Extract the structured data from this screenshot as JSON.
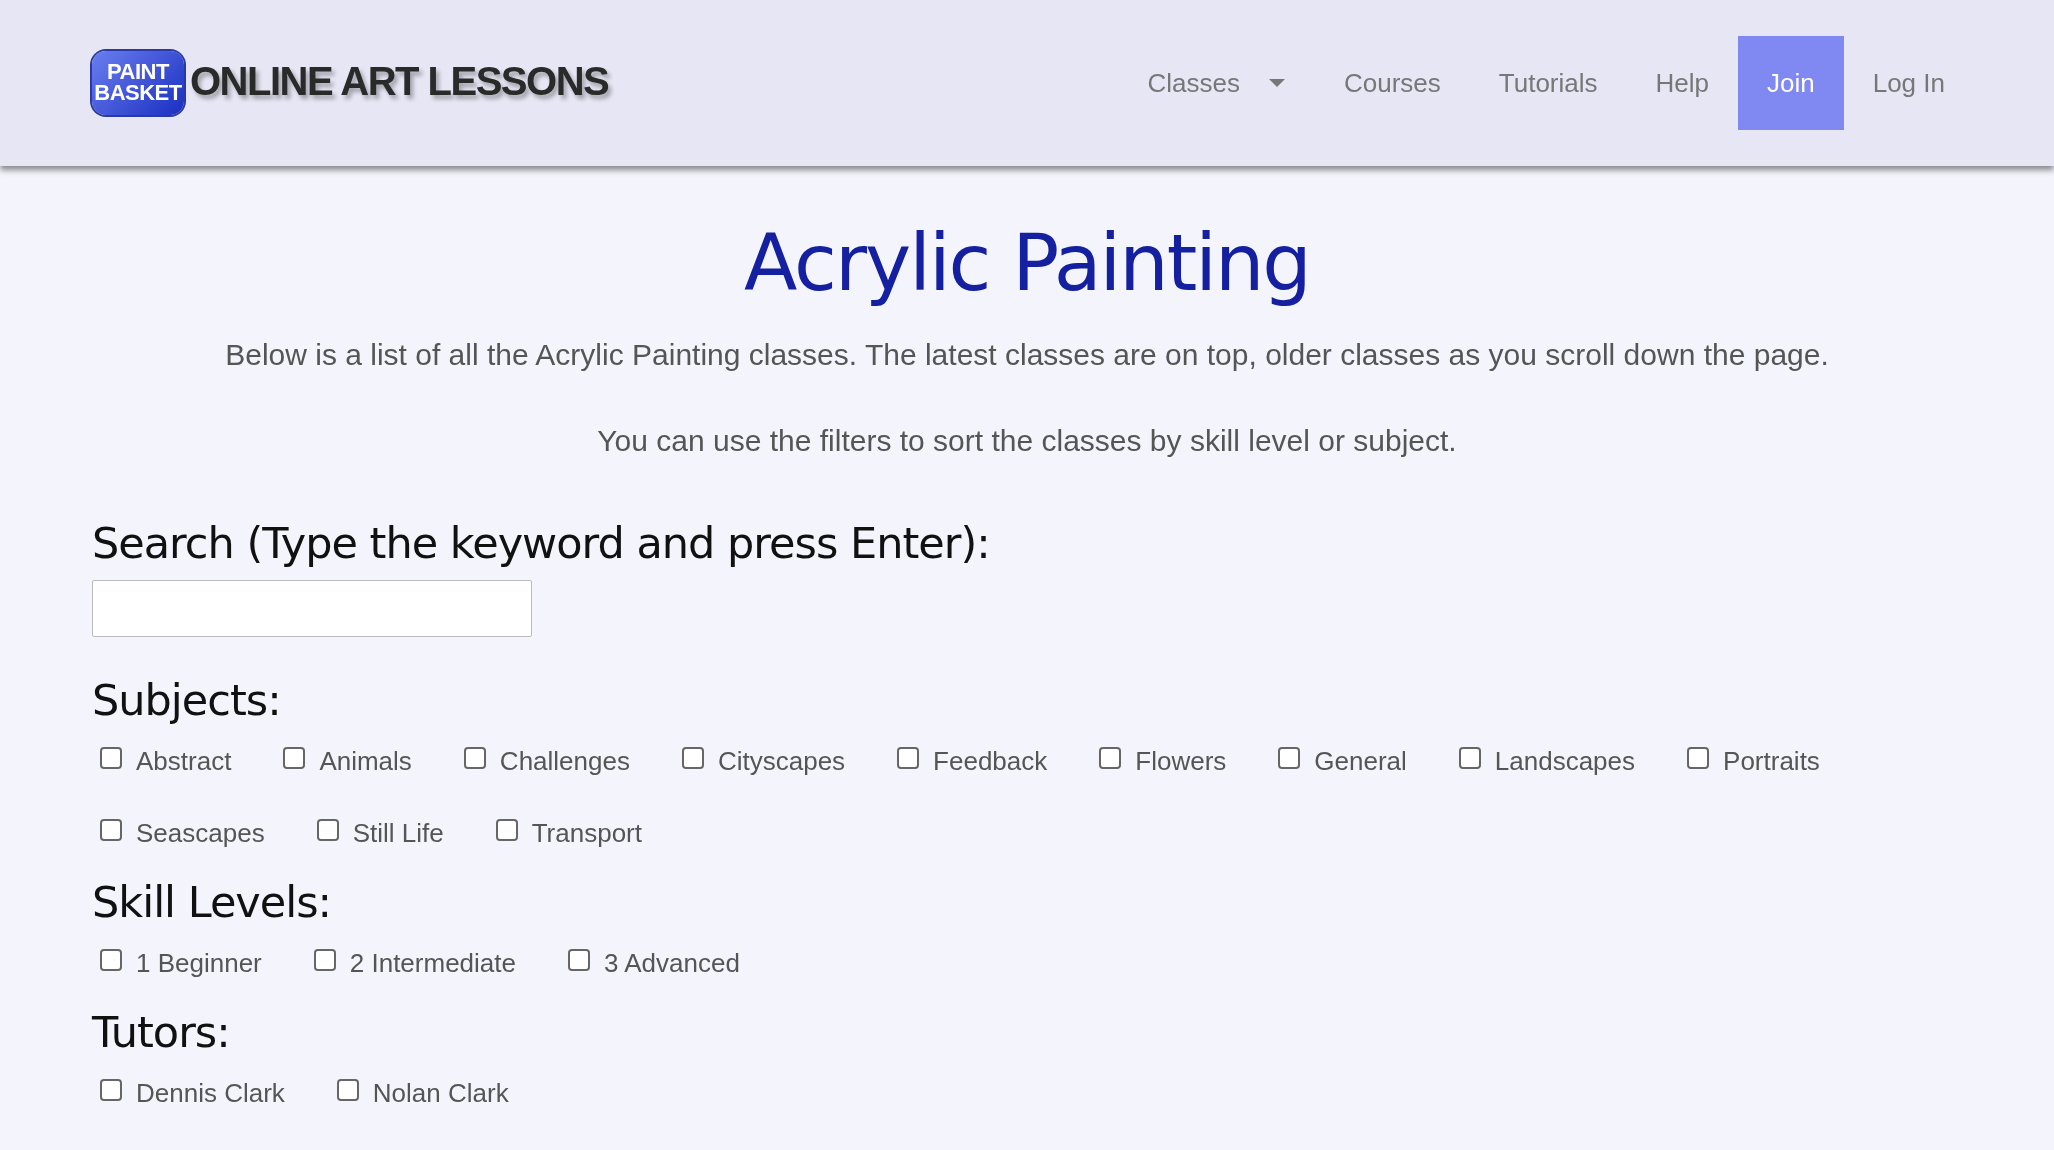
{
  "logo": {
    "badge_lines": [
      "PAINT",
      "BASKET"
    ],
    "wordmark": "ONLINE ART LESSONS"
  },
  "nav": [
    {
      "label": "Classes",
      "dropdown": true,
      "highlighted": false
    },
    {
      "label": "Courses",
      "dropdown": false,
      "highlighted": false
    },
    {
      "label": "Tutorials",
      "dropdown": false,
      "highlighted": false
    },
    {
      "label": "Help",
      "dropdown": false,
      "highlighted": false
    },
    {
      "label": "Join",
      "dropdown": false,
      "highlighted": true
    },
    {
      "label": "Log In",
      "dropdown": false,
      "highlighted": false
    }
  ],
  "title": "Acrylic Painting",
  "intro": [
    "Below is a list of all the Acrylic Painting classes. The latest classes are on top, older classes as you scroll down the page.",
    "You can use the filters to sort the classes by skill level or subject."
  ],
  "search": {
    "label": "Search (Type the keyword and press Enter):"
  },
  "filters": [
    {
      "heading": "Subjects:",
      "options": [
        {
          "label": "Abstract",
          "checked": false
        },
        {
          "label": "Animals",
          "checked": false
        },
        {
          "label": "Challenges",
          "checked": false
        },
        {
          "label": "Cityscapes",
          "checked": false
        },
        {
          "label": "Feedback",
          "checked": false
        },
        {
          "label": "Flowers",
          "checked": false
        },
        {
          "label": "General",
          "checked": false
        },
        {
          "label": "Landscapes",
          "checked": false
        },
        {
          "label": "Portraits",
          "checked": false
        },
        {
          "label": "Seascapes",
          "checked": false
        },
        {
          "label": "Still Life",
          "checked": false
        },
        {
          "label": "Transport",
          "checked": false
        }
      ]
    },
    {
      "heading": "Skill Levels:",
      "options": [
        {
          "label": "1 Beginner",
          "checked": false
        },
        {
          "label": "2 Intermediate",
          "checked": false
        },
        {
          "label": "3 Advanced",
          "checked": false
        }
      ]
    },
    {
      "heading": "Tutors:",
      "options": [
        {
          "label": "Dennis Clark",
          "checked": false
        },
        {
          "label": "Nolan Clark",
          "checked": false
        }
      ]
    }
  ]
}
